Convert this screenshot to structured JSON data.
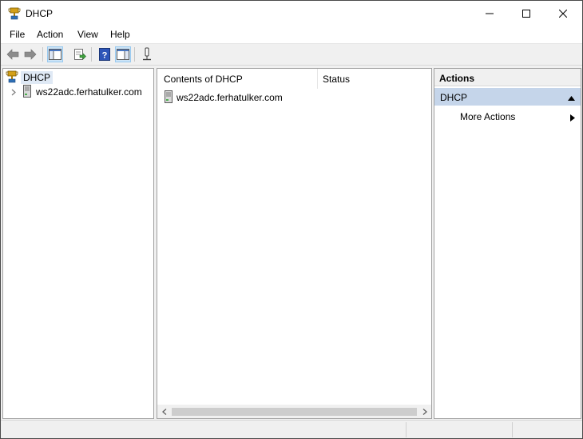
{
  "window": {
    "title": "DHCP"
  },
  "menu": {
    "items": [
      "File",
      "Action",
      "View",
      "Help"
    ]
  },
  "toolbar": {
    "buttons": [
      "back-arrow-icon",
      "forward-arrow-icon",
      "show-hide-console-tree-icon",
      "export-list-icon",
      "help-icon",
      "show-hide-action-pane-icon",
      "add-remove-column-icon"
    ]
  },
  "tree": {
    "root_label": "DHCP",
    "children": [
      {
        "label": "ws22adc.ferhatulker.com"
      }
    ]
  },
  "content": {
    "columns": [
      "Contents of DHCP",
      "Status"
    ],
    "rows": [
      {
        "name": "ws22adc.ferhatulker.com",
        "status": ""
      }
    ]
  },
  "actions": {
    "header": "Actions",
    "section_title": "DHCP",
    "items": [
      {
        "label": "More Actions"
      }
    ]
  },
  "colors": {
    "selection_bg": "#dfe9f5",
    "actions_section_bg": "#c5d5ea",
    "active_tool_bg": "#cce4f7"
  }
}
